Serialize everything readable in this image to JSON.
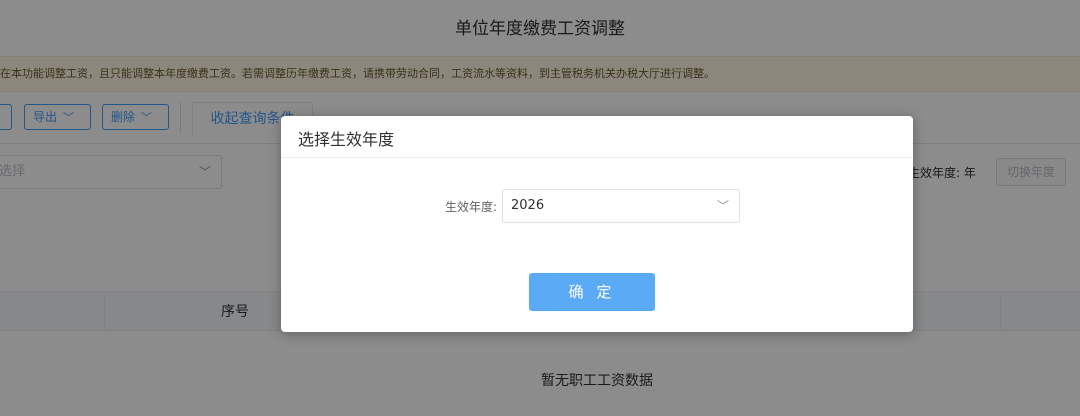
{
  "page": {
    "title": "单位年度缴费工资调整",
    "notice": "在本功能调整工资，且只能调整本年度缴费工资。若需调整历年缴费工资，请携带劳动合同，工资流水等资料，到主管税务机关办税大厅进行调整。"
  },
  "toolbar": {
    "export_label": "导出",
    "delete_label": "删除",
    "collapse_tab_label": "收起查询条件"
  },
  "filter": {
    "select_placeholder": "选择",
    "effective_year_label": "生效年度: 年",
    "switch_year_label": "切换年度"
  },
  "table": {
    "columns": [
      "序号"
    ],
    "empty_text": "暂无职工工资数据"
  },
  "dialog": {
    "title": "选择生效年度",
    "field_label": "生效年度:",
    "year_value": "2026",
    "confirm_label": "确 定"
  },
  "icons": {
    "chevron": "chevron-down-icon"
  },
  "colors": {
    "primary": "#409eff",
    "confirm_button": "#5aaaf5",
    "notice_bg": "#fdf6e4"
  }
}
